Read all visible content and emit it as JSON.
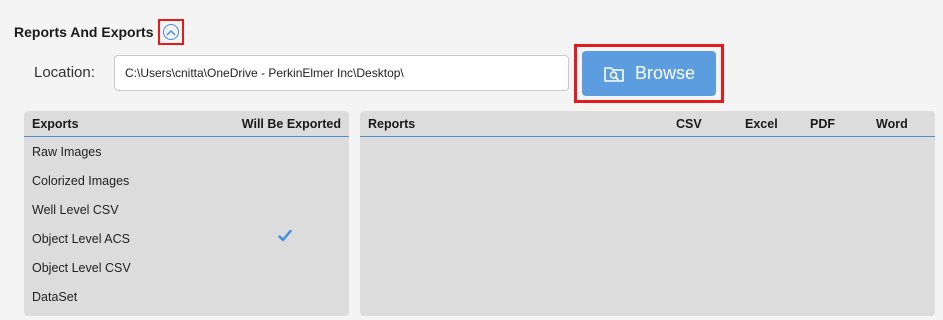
{
  "section": {
    "title": "Reports And Exports",
    "collapse_icon": "chevron-up-circle-icon"
  },
  "location": {
    "label": "Location:",
    "value": "C:\\Users\\cnitta\\OneDrive - PerkinElmer Inc\\Desktop\\"
  },
  "browse": {
    "label": "Browse",
    "icon": "folder-search-icon"
  },
  "exports": {
    "columns": [
      "Exports",
      "Will Be Exported"
    ],
    "rows": [
      {
        "name": "Raw Images",
        "exported": false
      },
      {
        "name": "Colorized Images",
        "exported": false
      },
      {
        "name": "Well Level CSV",
        "exported": false
      },
      {
        "name": "Object Level ACS",
        "exported": true
      },
      {
        "name": "Object Level CSV",
        "exported": false
      },
      {
        "name": "DataSet",
        "exported": false
      }
    ]
  },
  "reports": {
    "columns": [
      "Reports",
      "CSV",
      "Excel",
      "PDF",
      "Word"
    ]
  },
  "colors": {
    "accent": "#4a90d9",
    "browse_bg": "#5b9ddf",
    "highlight": "#e21b1b",
    "check": "#3b8ee6"
  }
}
